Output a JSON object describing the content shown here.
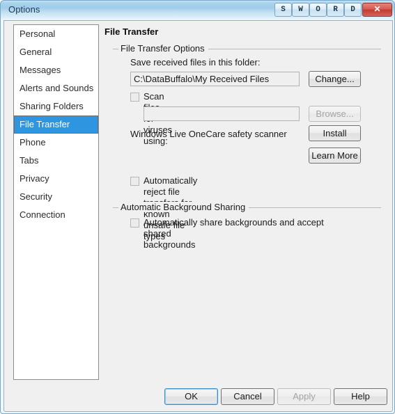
{
  "window": {
    "title": "Options",
    "titlebar_buttons": [
      {
        "label": "S",
        "name": "titlebar-button-s"
      },
      {
        "label": "W",
        "name": "titlebar-button-w"
      },
      {
        "label": "O",
        "name": "titlebar-button-o"
      },
      {
        "label": "R",
        "name": "titlebar-button-r"
      },
      {
        "label": "D",
        "name": "titlebar-button-d"
      }
    ],
    "close_label": "✕",
    "accent_color": "#2e95e0",
    "close_color": "#bf3c33"
  },
  "sidebar": {
    "items": [
      {
        "label": "Personal",
        "selected": false
      },
      {
        "label": "General",
        "selected": false
      },
      {
        "label": "Messages",
        "selected": false
      },
      {
        "label": "Alerts and Sounds",
        "selected": false
      },
      {
        "label": "Sharing Folders",
        "selected": false
      },
      {
        "label": "File Transfer",
        "selected": true
      },
      {
        "label": "Phone",
        "selected": false
      },
      {
        "label": "Tabs",
        "selected": false
      },
      {
        "label": "Privacy",
        "selected": false
      },
      {
        "label": "Security",
        "selected": false
      },
      {
        "label": "Connection",
        "selected": false
      }
    ]
  },
  "main": {
    "page_title": "File Transfer",
    "group_file_transfer": {
      "legend": "File Transfer Options",
      "save_folder_label": "Save received files in this folder:",
      "save_folder_value": "C:\\DataBuffalo\\My Received Files",
      "change_button": "Change...",
      "scan_checkbox_label": "Scan files for viruses using:",
      "scan_checkbox_checked": false,
      "scanner_value": "",
      "scanner_placeholder": "",
      "browse_button": "Browse...",
      "browse_disabled": true,
      "onecare_label": "Windows Live OneCare safety scanner",
      "install_button": "Install",
      "learn_more_button": "Learn More",
      "reject_checkbox_label": "Automatically reject file transfers for known unsafe file types",
      "reject_checkbox_checked": false
    },
    "group_background_sharing": {
      "legend": "Automatic Background Sharing",
      "share_checkbox_label": "Automatically share backgrounds and accept shared\nbackgrounds",
      "share_checkbox_checked": false
    }
  },
  "footer": {
    "ok_button": "OK",
    "cancel_button": "Cancel",
    "apply_button": "Apply",
    "apply_disabled": true,
    "help_button": "Help"
  }
}
